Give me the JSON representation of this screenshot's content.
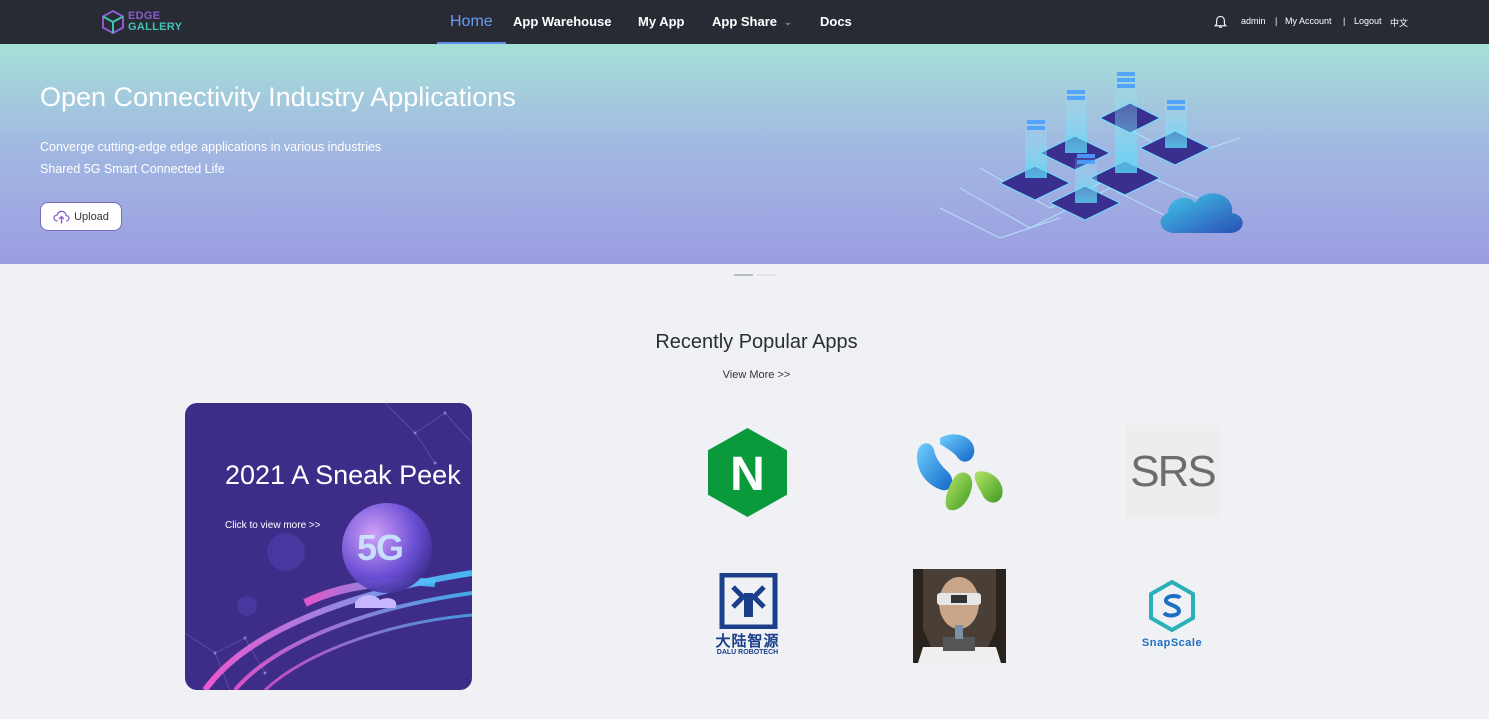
{
  "brand": {
    "line1": "EDGE",
    "line2": "GALLERY"
  },
  "nav": {
    "home": "Home",
    "warehouse": "App Warehouse",
    "myapp": "My App",
    "share": "App Share",
    "docs": "Docs"
  },
  "user_menu": {
    "username": "admin",
    "sep": "|",
    "account": "My Account",
    "logout": "Logout",
    "language": "中文"
  },
  "banner": {
    "title": "Open Connectivity Industry Applications",
    "line1": "Converge cutting-edge edge applications in various industries",
    "line2": "Shared 5G Smart Connected Life",
    "upload_label": "Upload"
  },
  "popular": {
    "title": "Recently Popular Apps",
    "view_more": "View More >>"
  },
  "promo": {
    "title": "2021 A Sneak Peek",
    "link": "Click to view more >>",
    "badge": "5G"
  },
  "apps": [
    {
      "icon": "nginx-logo-icon",
      "text": "N"
    },
    {
      "icon": "petal-app-logo-icon",
      "text": ""
    },
    {
      "icon": "srs-logo-icon",
      "text": "SRS"
    },
    {
      "icon": "dalu-robotech-logo-icon",
      "text_cn": "大陆智源",
      "text_en": "DALU ROBOTECH"
    },
    {
      "icon": "vr-user-photo-icon",
      "text": ""
    },
    {
      "icon": "snapscale-logo-icon",
      "text": "SnapScale"
    }
  ],
  "colors": {
    "topbar": "#282b33",
    "active_nav": "#6b9bf0",
    "page_bg": "#eff1f5",
    "nginx_green": "#0a9a3c",
    "snapscale_blue": "#1d6fc4"
  }
}
